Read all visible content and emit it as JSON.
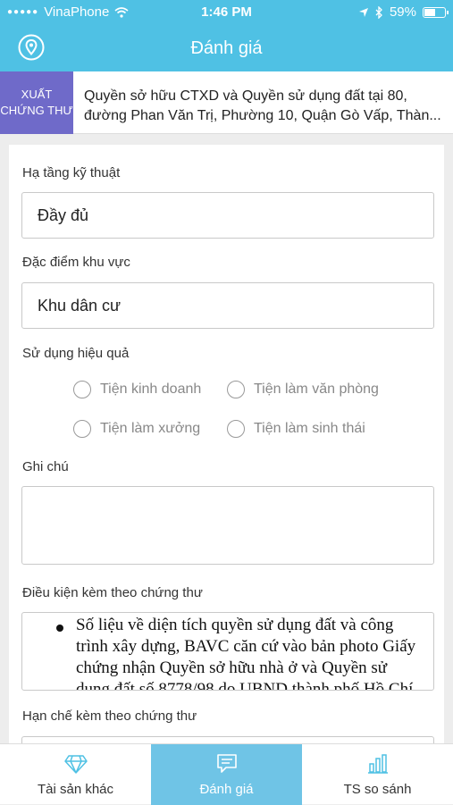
{
  "statusbar": {
    "carrier": "VinaPhone",
    "time": "1:46 PM",
    "battery": "59%",
    "battery_level": 0.59
  },
  "navbar": {
    "title": "Đánh giá",
    "location_icon": "location-pin-icon"
  },
  "banner": {
    "cert_label": "XUẤT\nCHỨNG THƯ",
    "address": "Quyền sở hữu CTXD và Quyền sử dụng đất tại 80, đường Phan Văn Trị, Phường 10, Quận Gò Vấp, Thàn..."
  },
  "form": {
    "infrastructure_label": "Hạ tầng kỹ thuật",
    "infrastructure_value": "Đầy đủ",
    "area_label": "Đặc điểm khu vực",
    "area_value": "Khu dân cư",
    "efficiency_label": "Sử dụng hiệu quả",
    "options": [
      "Tiện kinh doanh",
      "Tiện làm văn phòng",
      "Tiện làm xưởng",
      "Tiện làm sinh thái"
    ],
    "note_label": "Ghi chú",
    "note_value": "",
    "conditions_label": "Điều kiện kèm theo chứng thư",
    "conditions_text": "Số liệu về diện tích quyền sử dụng đất và công trình xây dựng, BAVC căn cứ vào bản photo Giấy chứng nhận Quyền sở hữu nhà ở và Quyền sử dụng đất số 8778/98 do UBND thành phố Hồ Chí",
    "restrictions_label": "Hạn chế kèm theo chứng thư"
  },
  "tabbar": {
    "tabs": [
      {
        "label": "Tài sản khác",
        "icon": "diamond-icon"
      },
      {
        "label": "Đánh giá",
        "icon": "chat-icon"
      },
      {
        "label": "TS so sánh",
        "icon": "bar-chart-icon"
      }
    ],
    "active": 1
  },
  "colors": {
    "primary": "#4fc1e4",
    "cert_button": "#6f6ac9",
    "active_tab": "#6fc4e6"
  }
}
